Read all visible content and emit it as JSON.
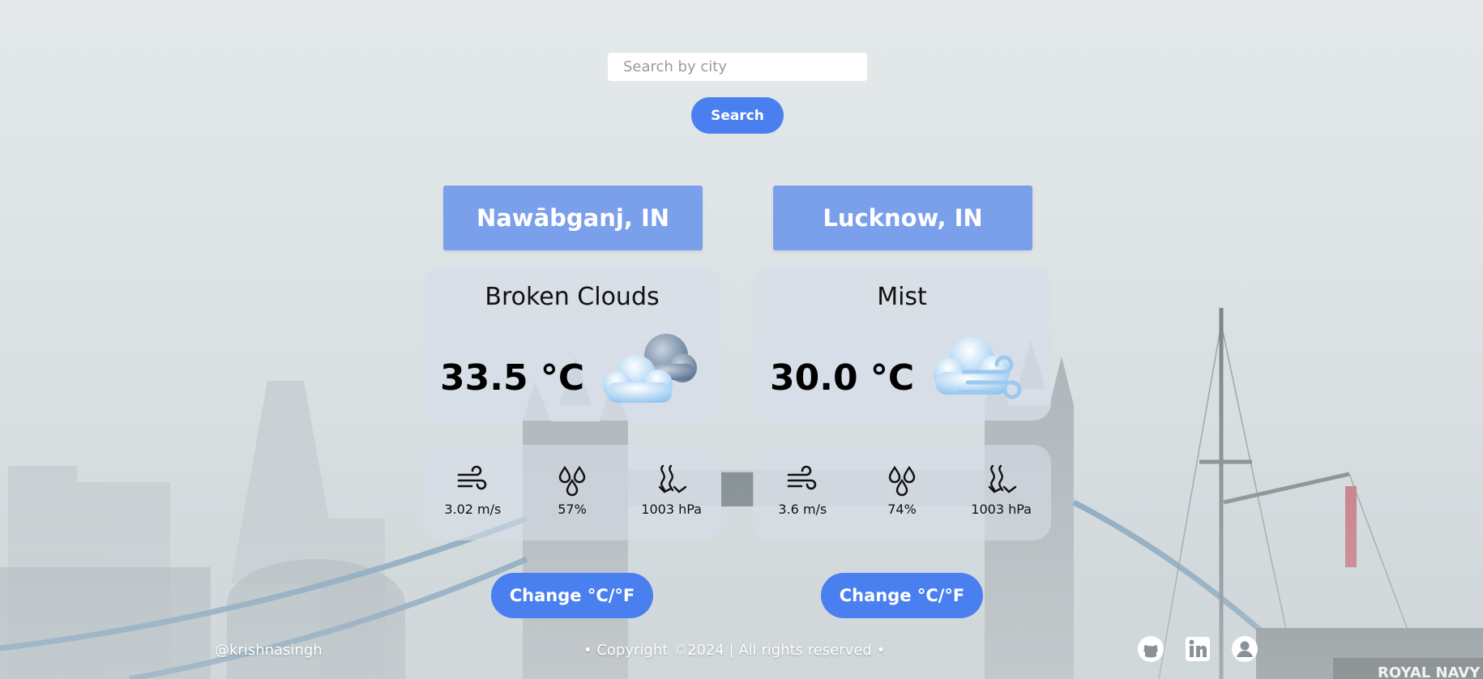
{
  "search": {
    "placeholder": "Search by city",
    "button_label": "Search"
  },
  "cards": [
    {
      "city": "Nawābganj, IN",
      "condition": "Broken Clouds",
      "temperature": "33.5 °C",
      "icon": "broken-clouds-icon",
      "wind": "3.02 m/s",
      "humidity": "57%",
      "pressure": "1003 hPa",
      "toggle_label": "Change °C/°F"
    },
    {
      "city": "Lucknow, IN",
      "condition": "Mist",
      "temperature": "30.0 °C",
      "icon": "mist-icon",
      "wind": "3.6 m/s",
      "humidity": "74%",
      "pressure": "1003 hPa",
      "toggle_label": "Change °C/°F"
    }
  ],
  "footer": {
    "handle": "@krishnasingh",
    "copyright": "• Copyright ©2024 | All rights reserved •",
    "links": [
      "github-icon",
      "linkedin-icon",
      "profile-icon"
    ]
  },
  "colors": {
    "accent": "#4a7ff0",
    "city_header": "#6c95ec"
  }
}
